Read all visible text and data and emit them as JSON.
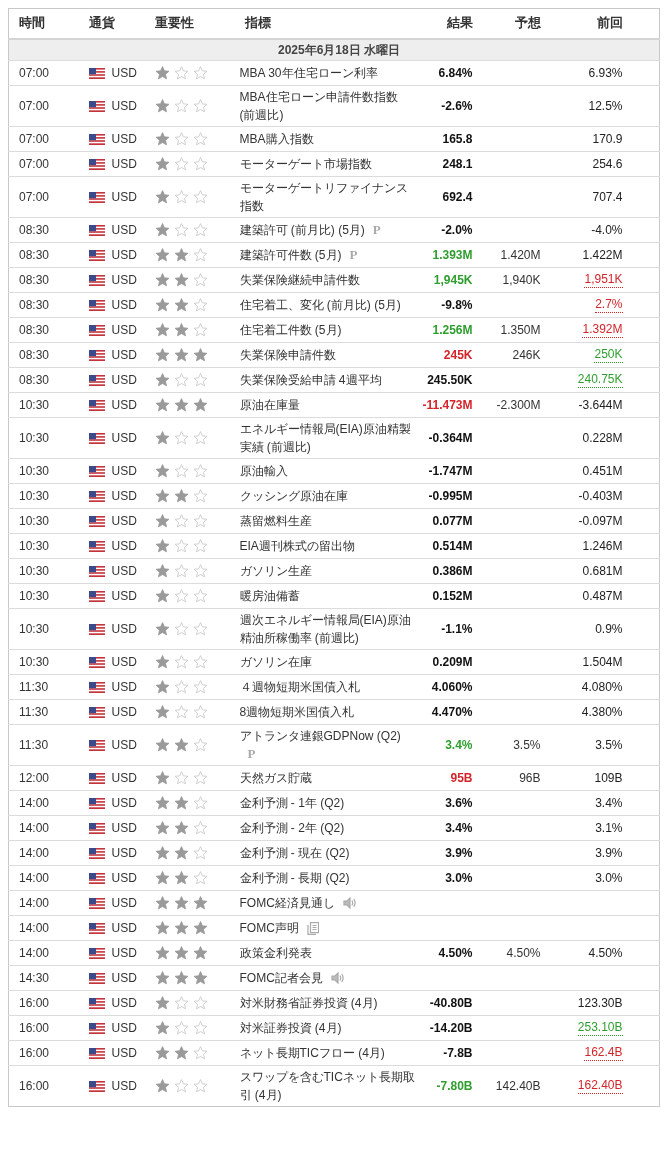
{
  "columns": [
    "時間",
    "通貨",
    "重要性",
    "指標",
    "結果",
    "予想",
    "前回"
  ],
  "date": "2025年6月18日 水曜日",
  "rows": [
    {
      "time": "07:00",
      "currency": "USD",
      "stars": 1,
      "indicator": {
        "text": "MBA 30年住宅ローン利率"
      },
      "result": {
        "text": "6.84%"
      },
      "previous": {
        "text": "6.93%"
      }
    },
    {
      "time": "07:00",
      "currency": "USD",
      "stars": 1,
      "indicator": {
        "text": "MBA住宅ローン申請件数指数 (前週比)"
      },
      "result": {
        "text": "-2.6%"
      },
      "previous": {
        "text": "12.5%"
      }
    },
    {
      "time": "07:00",
      "currency": "USD",
      "stars": 1,
      "indicator": {
        "text": "MBA購入指数"
      },
      "result": {
        "text": "165.8"
      },
      "previous": {
        "text": "170.9"
      }
    },
    {
      "time": "07:00",
      "currency": "USD",
      "stars": 1,
      "indicator": {
        "text": "モーターゲート市場指数"
      },
      "result": {
        "text": "248.1"
      },
      "previous": {
        "text": "254.6"
      }
    },
    {
      "time": "07:00",
      "currency": "USD",
      "stars": 1,
      "indicator": {
        "text": "モーターゲートリファイナンス指数"
      },
      "result": {
        "text": "692.4"
      },
      "previous": {
        "text": "707.4"
      }
    },
    {
      "time": "08:30",
      "currency": "USD",
      "stars": 1,
      "indicator": {
        "text": "建築許可 (前月比) (5月)",
        "marker": "P"
      },
      "result": {
        "text": "-2.0%"
      },
      "previous": {
        "text": "-4.0%"
      }
    },
    {
      "time": "08:30",
      "currency": "USD",
      "stars": 2,
      "indicator": {
        "text": "建築許可件数 (5月)",
        "marker": "P"
      },
      "result": {
        "text": "1.393M",
        "color": "#2f9e2f"
      },
      "forecast": "1.420M",
      "previous": {
        "text": "1.422M"
      }
    },
    {
      "time": "08:30",
      "currency": "USD",
      "stars": 2,
      "indicator": {
        "text": "失業保険継続申請件数"
      },
      "result": {
        "text": "1,945K",
        "color": "#2f9e2f"
      },
      "forecast": "1,940K",
      "previous": {
        "text": "1,951K",
        "color": "#d4242a"
      }
    },
    {
      "time": "08:30",
      "currency": "USD",
      "stars": 2,
      "indicator": {
        "text": "住宅着工、変化 (前月比) (5月)"
      },
      "result": {
        "text": "-9.8%"
      },
      "previous": {
        "text": "2.7%",
        "color": "#d4242a"
      }
    },
    {
      "time": "08:30",
      "currency": "USD",
      "stars": 2,
      "indicator": {
        "text": "住宅着工件数 (5月)"
      },
      "result": {
        "text": "1.256M",
        "color": "#2f9e2f"
      },
      "forecast": "1.350M",
      "previous": {
        "text": "1.392M",
        "color": "#d4242a"
      }
    },
    {
      "time": "08:30",
      "currency": "USD",
      "stars": 3,
      "indicator": {
        "text": "失業保険申請件数"
      },
      "result": {
        "text": "245K",
        "color": "#d4242a"
      },
      "forecast": "246K",
      "previous": {
        "text": "250K",
        "color": "#2f9e2f"
      }
    },
    {
      "time": "08:30",
      "currency": "USD",
      "stars": 1,
      "indicator": {
        "text": "失業保険受給申請 4週平均"
      },
      "result": {
        "text": "245.50K"
      },
      "previous": {
        "text": "240.75K",
        "color": "#2f9e2f"
      }
    },
    {
      "time": "10:30",
      "currency": "USD",
      "stars": 3,
      "indicator": {
        "text": "原油在庫量"
      },
      "result": {
        "text": "-11.473M",
        "color": "#d4242a"
      },
      "forecast": "-2.300M",
      "previous": {
        "text": "-3.644M"
      }
    },
    {
      "time": "10:30",
      "currency": "USD",
      "stars": 1,
      "indicator": {
        "text": "エネルギー情報局(EIA)原油精製実績 (前週比)"
      },
      "result": {
        "text": "-0.364M"
      },
      "previous": {
        "text": "0.228M"
      }
    },
    {
      "time": "10:30",
      "currency": "USD",
      "stars": 1,
      "indicator": {
        "text": "原油輸入"
      },
      "result": {
        "text": "-1.747M"
      },
      "previous": {
        "text": "0.451M"
      }
    },
    {
      "time": "10:30",
      "currency": "USD",
      "stars": 2,
      "indicator": {
        "text": "クッシング原油在庫"
      },
      "result": {
        "text": "-0.995M"
      },
      "previous": {
        "text": "-0.403M"
      }
    },
    {
      "time": "10:30",
      "currency": "USD",
      "stars": 1,
      "indicator": {
        "text": "蒸留燃料生産"
      },
      "result": {
        "text": "0.077M"
      },
      "previous": {
        "text": "-0.097M"
      }
    },
    {
      "time": "10:30",
      "currency": "USD",
      "stars": 1,
      "indicator": {
        "text": "EIA週刊株式の留出物"
      },
      "result": {
        "text": "0.514M"
      },
      "previous": {
        "text": "1.246M"
      }
    },
    {
      "time": "10:30",
      "currency": "USD",
      "stars": 1,
      "indicator": {
        "text": "ガソリン生産"
      },
      "result": {
        "text": "0.386M"
      },
      "previous": {
        "text": "0.681M"
      }
    },
    {
      "time": "10:30",
      "currency": "USD",
      "stars": 1,
      "indicator": {
        "text": "暖房油備蓄"
      },
      "result": {
        "text": "0.152M"
      },
      "previous": {
        "text": "0.487M"
      }
    },
    {
      "time": "10:30",
      "currency": "USD",
      "stars": 1,
      "indicator": {
        "text": "週次エネルギー情報局(EIA)原油精油所稼働率 (前週比)"
      },
      "result": {
        "text": "-1.1%"
      },
      "previous": {
        "text": "0.9%"
      }
    },
    {
      "time": "10:30",
      "currency": "USD",
      "stars": 1,
      "indicator": {
        "text": "ガソリン在庫"
      },
      "result": {
        "text": "0.209M"
      },
      "previous": {
        "text": "1.504M"
      }
    },
    {
      "time": "11:30",
      "currency": "USD",
      "stars": 1,
      "indicator": {
        "text": "４週物短期米国債入札"
      },
      "result": {
        "text": "4.060%"
      },
      "previous": {
        "text": "4.080%"
      }
    },
    {
      "time": "11:30",
      "currency": "USD",
      "stars": 1,
      "indicator": {
        "text": "8週物短期米国債入札"
      },
      "result": {
        "text": "4.470%"
      },
      "previous": {
        "text": "4.380%"
      }
    },
    {
      "time": "11:30",
      "currency": "USD",
      "stars": 2,
      "indicator": {
        "text": "アトランタ連銀GDPNow (Q2)",
        "marker": "P"
      },
      "result": {
        "text": "3.4%",
        "color": "#2f9e2f"
      },
      "forecast": "3.5%",
      "previous": {
        "text": "3.5%"
      }
    },
    {
      "time": "12:00",
      "currency": "USD",
      "stars": 1,
      "indicator": {
        "text": "天然ガス貯蔵"
      },
      "result": {
        "text": "95B",
        "color": "#d4242a"
      },
      "forecast": "96B",
      "previous": {
        "text": "109B"
      }
    },
    {
      "time": "14:00",
      "currency": "USD",
      "stars": 2,
      "indicator": {
        "text": "金利予測 - 1年 (Q2)"
      },
      "result": {
        "text": "3.6%"
      },
      "previous": {
        "text": "3.4%"
      }
    },
    {
      "time": "14:00",
      "currency": "USD",
      "stars": 2,
      "indicator": {
        "text": "金利予測 - 2年 (Q2)"
      },
      "result": {
        "text": "3.4%"
      },
      "previous": {
        "text": "3.1%"
      }
    },
    {
      "time": "14:00",
      "currency": "USD",
      "stars": 2,
      "indicator": {
        "text": "金利予測 - 現在 (Q2)"
      },
      "result": {
        "text": "3.9%"
      },
      "previous": {
        "text": "3.9%"
      }
    },
    {
      "time": "14:00",
      "currency": "USD",
      "stars": 2,
      "indicator": {
        "text": "金利予測 - 長期 (Q2)"
      },
      "result": {
        "text": "3.0%"
      },
      "previous": {
        "text": "3.0%"
      }
    },
    {
      "time": "14:00",
      "currency": "USD",
      "stars": 3,
      "indicator": {
        "text": "FOMC経済見通し",
        "kind": "speaker"
      }
    },
    {
      "time": "14:00",
      "currency": "USD",
      "stars": 3,
      "indicator": {
        "text": "FOMC声明",
        "kind": "document"
      }
    },
    {
      "time": "14:00",
      "currency": "USD",
      "stars": 3,
      "indicator": {
        "text": "政策金利発表"
      },
      "result": {
        "text": "4.50%"
      },
      "forecast": "4.50%",
      "previous": {
        "text": "4.50%"
      }
    },
    {
      "time": "14:30",
      "currency": "USD",
      "stars": 3,
      "indicator": {
        "text": "FOMC記者会見",
        "kind": "speaker"
      }
    },
    {
      "time": "16:00",
      "currency": "USD",
      "stars": 1,
      "indicator": {
        "text": "対米財務省証券投資 (4月)"
      },
      "result": {
        "text": "-40.80B"
      },
      "previous": {
        "text": "123.30B"
      }
    },
    {
      "time": "16:00",
      "currency": "USD",
      "stars": 1,
      "indicator": {
        "text": "対米証券投資 (4月)"
      },
      "result": {
        "text": "-14.20B"
      },
      "previous": {
        "text": "253.10B",
        "color": "#2f9e2f"
      }
    },
    {
      "time": "16:00",
      "currency": "USD",
      "stars": 2,
      "indicator": {
        "text": "ネット長期TICフロー (4月)"
      },
      "result": {
        "text": "-7.8B"
      },
      "previous": {
        "text": "162.4B",
        "color": "#d4242a"
      }
    },
    {
      "time": "16:00",
      "currency": "USD",
      "stars": 1,
      "indicator": {
        "text": "スワップを含むTICネット長期取引 (4月)"
      },
      "result": {
        "text": "-7.80B",
        "color": "#2f9e2f"
      },
      "forecast": "142.40B",
      "previous": {
        "text": "162.40B",
        "color": "#d4242a"
      }
    }
  ]
}
